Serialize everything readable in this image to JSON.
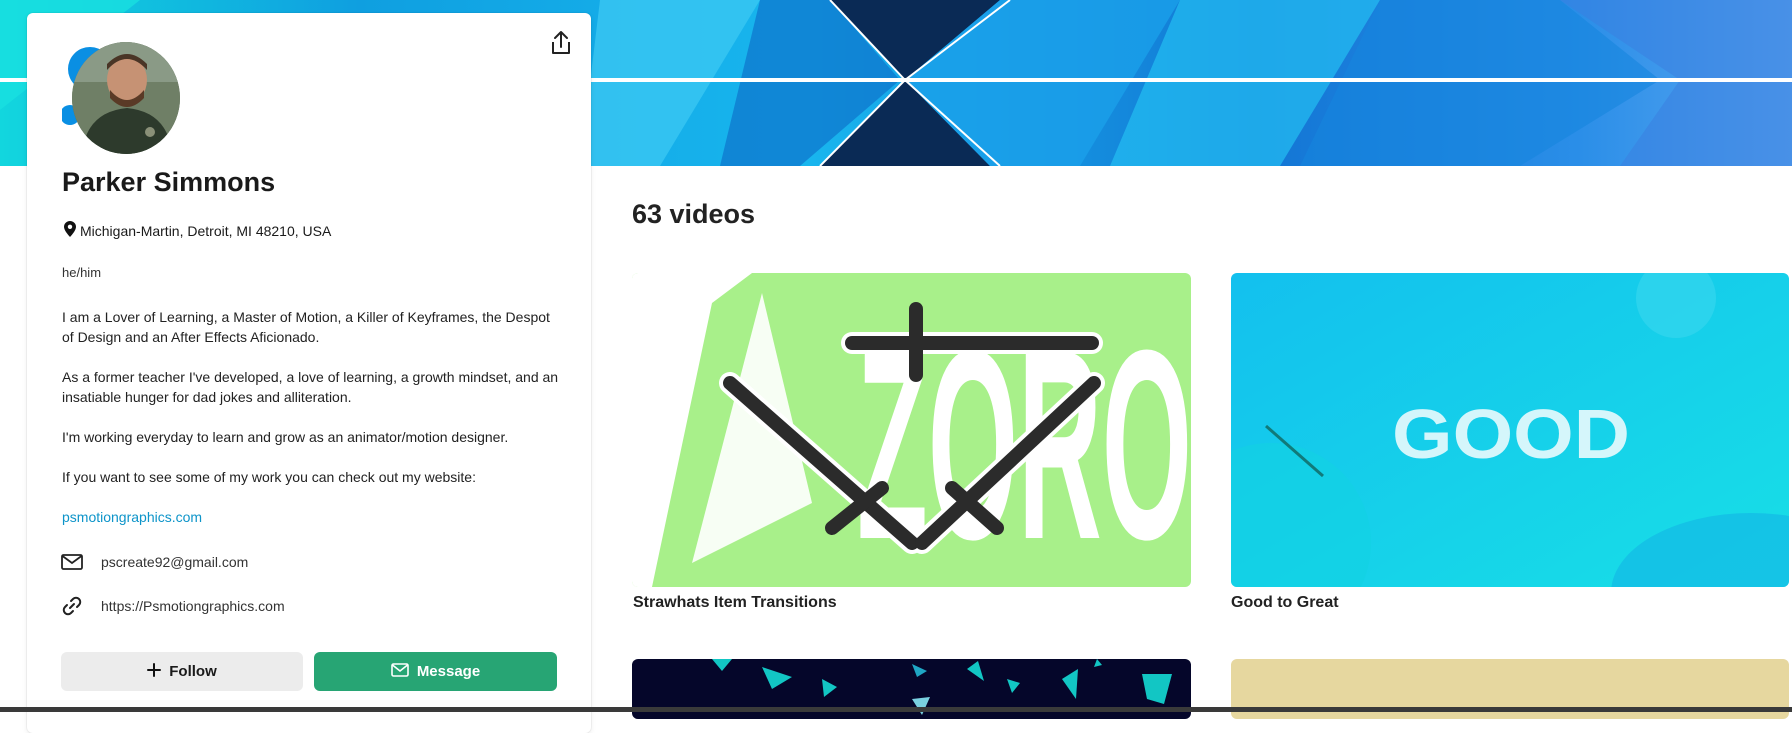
{
  "profile": {
    "name": "Parker Simmons",
    "location": "Michigan-Martin, Detroit, MI 48210, USA",
    "pronouns": "he/him",
    "bio": [
      "I am a Lover of Learning, a Master of Motion, a Killer of Keyframes, the Despot of Design and an After Effects Aficionado.",
      "As a former teacher I've developed, a love of learning, a growth mindset, and an insatiable hunger for dad jokes and alliteration.",
      "I'm working everyday to learn and grow as an animator/motion designer.",
      "If you want to see some of my work you can check out my website:"
    ],
    "website_link": "psmotiongraphics.com",
    "email": "pscreate92@gmail.com",
    "url": "https://Psmotiongraphics.com"
  },
  "buttons": {
    "follow": "Follow",
    "message": "Message"
  },
  "icons": {
    "share": "share-icon",
    "location": "map-pin-icon",
    "email": "envelope-icon",
    "link": "link-icon",
    "follow": "plus-icon",
    "message": "envelope-icon"
  },
  "colors": {
    "accent_green": "#27a574",
    "link_blue": "#0d94c9"
  },
  "videos": {
    "count_label": "63 videos",
    "items": [
      {
        "title": "Strawhats Item Transitions",
        "thumb_text": "ZORO"
      },
      {
        "title": "Good to Great",
        "thumb_text": "GOOD"
      },
      {
        "title": ""
      },
      {
        "title": ""
      }
    ]
  }
}
